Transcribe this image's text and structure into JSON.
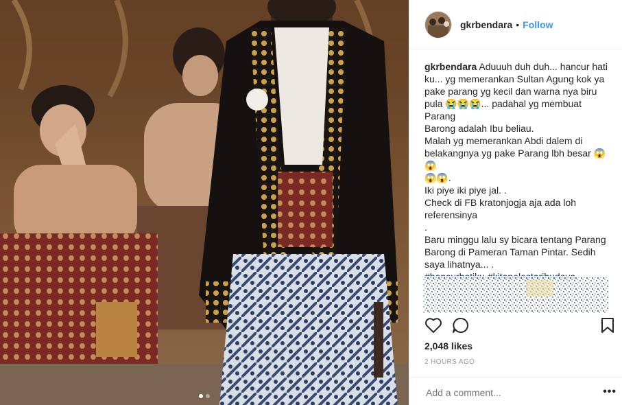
{
  "post": {
    "username": "gkrbendara",
    "separator": "•",
    "follow_label": "Follow",
    "caption_lines": [
      "Aduuuh duh duh... hancur hati",
      "ku... yg memerankan Sultan Agung kok ya",
      "pake parang yg kecil dan warna nya biru",
      "pula 😭😭😭... padahal yg membuat Parang",
      "Barong adalah Ibu beliau.",
      "Malah yg memerankan Abdi dalem di",
      "belakangnya yg pake Parang lbh besar 😱😱",
      "😱😱.",
      "Iki piye iki piye jal. .",
      "Check di FB kratonjogja aja ada loh",
      "referensinya",
      ".",
      "Baru minggu lalu sy bicara tentang Parang",
      "Barong di Pameran Taman Pintar. Sedih",
      "saya lihatnya... ."
    ],
    "hashtags": [
      "#hancurhatiku",
      "#kitapelestaribudaya"
    ],
    "likes": "2,048 likes",
    "timestamp": "2 HOURS AGO",
    "comment_placeholder": "Add a comment...",
    "more_label": "•••",
    "carousel": {
      "count": 2,
      "active_index": 0
    }
  },
  "icons": {
    "like": "heart-icon",
    "comment": "comment-bubble-icon",
    "save": "bookmark-icon",
    "options": "more-options-icon"
  },
  "colors": {
    "link": "#3897f0",
    "hashtag": "#003569",
    "muted": "#999999",
    "text": "#262626",
    "border": "#efefef"
  }
}
